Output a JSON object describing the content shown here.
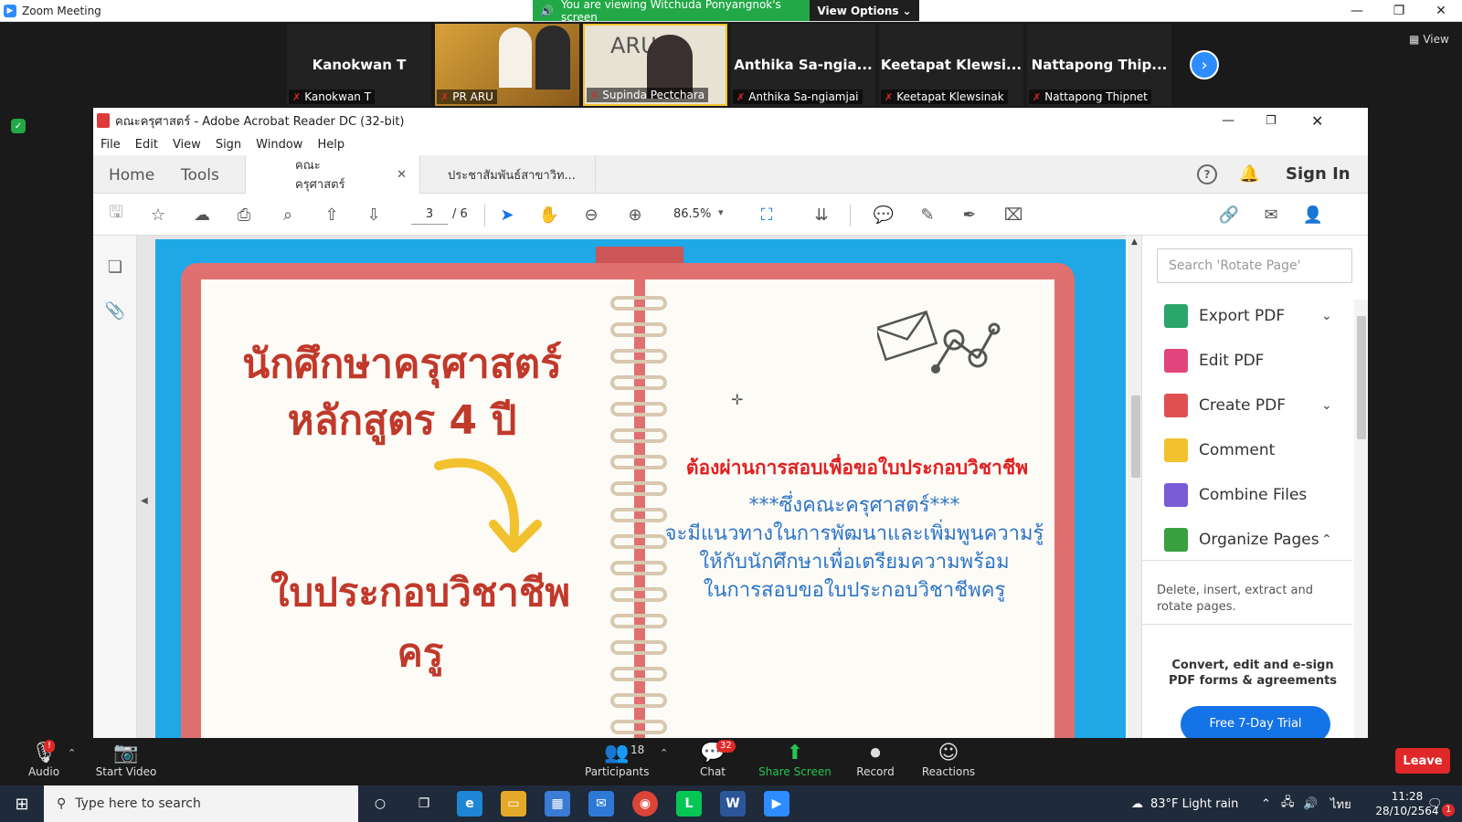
{
  "zoom": {
    "window_title": "Zoom Meeting",
    "viewing_banner": "You are viewing Witchuda Ponyangnok's screen",
    "view_options": "View Options",
    "view_label": "View",
    "participants": [
      {
        "big": "Kanokwan T",
        "name": "Kanokwan T"
      },
      {
        "big": "",
        "name": "PR ARU"
      },
      {
        "big": "",
        "name": "Supinda Pectchara"
      },
      {
        "big": "Anthika Sa-ngia...",
        "name": "Anthika Sa-ngiamjai"
      },
      {
        "big": "Keetapat Klewsi...",
        "name": "Keetapat Klewsinak"
      },
      {
        "big": "Nattapong Thip...",
        "name": "Nattapong Thipnet"
      }
    ],
    "bottom": {
      "audio": "Audio",
      "start_video": "Start Video",
      "participants": "Participants",
      "participants_count": "18",
      "chat": "Chat",
      "chat_badge": "32",
      "share_screen": "Share Screen",
      "record": "Record",
      "reactions": "Reactions",
      "leave": "Leave",
      "audio_badge": "!"
    }
  },
  "acrobat": {
    "title": "คณะครุศาสตร์ - Adobe Acrobat Reader DC (32-bit)",
    "menu": [
      "File",
      "Edit",
      "View",
      "Sign",
      "Window",
      "Help"
    ],
    "nav_home": "Home",
    "nav_tools": "Tools",
    "tabs": [
      {
        "label": "คณะครุศาสตร์",
        "active": true
      },
      {
        "label": "ประชาสัมพันธ์สาขาวิท...",
        "active": false
      }
    ],
    "sign_in": "Sign In",
    "page_current": "3",
    "page_total": "/ 6",
    "zoom": "86.5%",
    "tools_search_placeholder": "Search 'Rotate Page'",
    "tools": [
      {
        "label": "Export PDF",
        "chevron": "⌄",
        "color": "#2aa56b"
      },
      {
        "label": "Edit PDF",
        "chevron": "",
        "color": "#e0457b"
      },
      {
        "label": "Create PDF",
        "chevron": "⌄",
        "color": "#e05050"
      },
      {
        "label": "Comment",
        "chevron": "",
        "color": "#f2c12e"
      },
      {
        "label": "Combine Files",
        "chevron": "",
        "color": "#7b5bd6"
      },
      {
        "label": "Organize Pages",
        "chevron": "⌃",
        "color": "#3aa040"
      }
    ],
    "tools_description": "Delete, insert, extract and rotate pages.",
    "promo": "Convert, edit and e-sign PDF forms & agreements",
    "trial_button": "Free 7-Day Trial"
  },
  "document": {
    "title_line1": "นักศึกษาครุศาสตร์",
    "title_line2": "หลักสูตร 4 ปี",
    "bottom_left": "ใบประกอบวิชาชีพครู",
    "red_line": "ต้องผ่านการสอบเพื่อขอใบประกอบวิชาชีพ",
    "blue_line1": "***ซึ่งคณะครุศาสตร์***",
    "blue_line2": "จะมีแนวทางในการพัฒนาและเพิ่มพูนความรู้",
    "blue_line3": "ให้กับนักศึกษาเพื่อเตรียมความพร้อม",
    "blue_line4": "ในการสอบขอใบประกอบวิชาชีพครู"
  },
  "taskbar": {
    "search_placeholder": "Type here to search",
    "weather": "83°F  Light rain",
    "lang": "ไทย",
    "time": "11:28",
    "date": "28/10/2564",
    "notif_count": "1"
  }
}
